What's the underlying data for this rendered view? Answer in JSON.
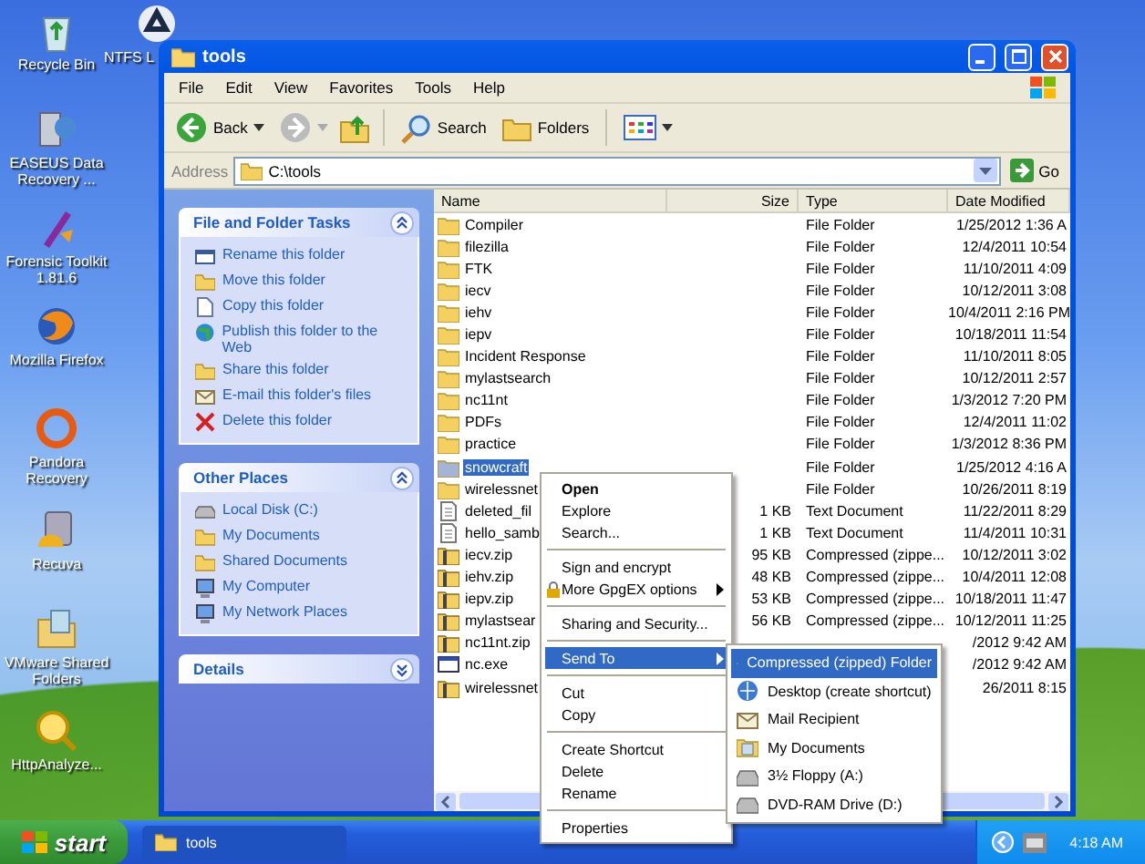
{
  "desktop_icons": [
    {
      "label": "Recycle Bin"
    },
    {
      "label": "NTFS L"
    },
    {
      "label": "EASEUS Data Recovery ..."
    },
    {
      "label": "Forensic Toolkit 1.81.6"
    },
    {
      "label": "Mozilla Firefox"
    },
    {
      "label": "Pandora Recovery"
    },
    {
      "label": "Recuva"
    },
    {
      "label": "VMware Shared Folders"
    },
    {
      "label": "HttpAnalyze..."
    }
  ],
  "window": {
    "title": "tools",
    "menu": [
      "File",
      "Edit",
      "View",
      "Favorites",
      "Tools",
      "Help"
    ],
    "toolbar": {
      "back": "Back",
      "search": "Search",
      "folders": "Folders"
    },
    "address": {
      "label": "Address",
      "value": "C:\\tools",
      "go": "Go"
    }
  },
  "task_panes": [
    {
      "title": "File and Folder Tasks",
      "expanded": true,
      "items": [
        "Rename this folder",
        "Move this folder",
        "Copy this folder",
        "Publish this folder to the Web",
        "Share this folder",
        "E-mail this folder's files",
        "Delete this folder"
      ]
    },
    {
      "title": "Other Places",
      "expanded": true,
      "items": [
        "Local Disk (C:)",
        "My Documents",
        "Shared Documents",
        "My Computer",
        "My Network Places"
      ]
    },
    {
      "title": "Details",
      "expanded": false
    }
  ],
  "file_list": {
    "columns": [
      "Name",
      "Size",
      "Type",
      "Date Modified"
    ],
    "rows": [
      {
        "kind": "folder",
        "name": "Compiler",
        "type": "File Folder",
        "date": "1/25/2012 1:36 A",
        "selected": false
      },
      {
        "kind": "folder",
        "name": "filezilla",
        "type": "File Folder",
        "date": "12/4/2011 10:54",
        "selected": false
      },
      {
        "kind": "folder",
        "name": "FTK",
        "type": "File Folder",
        "date": "11/10/2011 4:09",
        "selected": false
      },
      {
        "kind": "folder",
        "name": "iecv",
        "type": "File Folder",
        "date": "10/12/2011 3:08",
        "selected": false
      },
      {
        "kind": "folder",
        "name": "iehv",
        "type": "File Folder",
        "date": "10/4/2011 2:16 PM",
        "selected": false
      },
      {
        "kind": "folder",
        "name": "iepv",
        "type": "File Folder",
        "date": "10/18/2011 11:54",
        "selected": false
      },
      {
        "kind": "folder",
        "name": "Incident Response",
        "type": "File Folder",
        "date": "11/10/2011 8:05",
        "selected": false
      },
      {
        "kind": "folder",
        "name": "mylastsearch",
        "type": "File Folder",
        "date": "10/12/2011 2:57",
        "selected": false
      },
      {
        "kind": "folder",
        "name": "nc11nt",
        "type": "File Folder",
        "date": "1/3/2012 7:20 PM",
        "selected": false
      },
      {
        "kind": "folder",
        "name": "PDFs",
        "type": "File Folder",
        "date": "12/4/2011 11:02",
        "selected": false
      },
      {
        "kind": "folder",
        "name": "practice",
        "type": "File Folder",
        "date": "1/3/2012 8:36 PM",
        "selected": false
      },
      {
        "kind": "folder",
        "name": "snowcraft",
        "type": "File Folder",
        "date": "1/25/2012 4:16 A",
        "selected": true
      },
      {
        "kind": "folder",
        "name": "wirelessnet",
        "type": "File Folder",
        "date": "10/26/2011 8:19",
        "selected": false
      },
      {
        "kind": "text",
        "name": "deleted_fil",
        "size": "1 KB",
        "type": "Text Document",
        "date": "11/22/2011 8:29",
        "selected": false
      },
      {
        "kind": "text",
        "name": "hello_samb",
        "size": "1 KB",
        "type": "Text Document",
        "date": "11/4/2011 10:31",
        "selected": false
      },
      {
        "kind": "zip",
        "name": "iecv.zip",
        "size": "95 KB",
        "type": "Compressed (zippe...",
        "date": "10/12/2011 3:02",
        "selected": false
      },
      {
        "kind": "zip",
        "name": "iehv.zip",
        "size": "48 KB",
        "type": "Compressed (zippe...",
        "date": "10/4/2011 12:08",
        "selected": false
      },
      {
        "kind": "zip",
        "name": "iepv.zip",
        "size": "53 KB",
        "type": "Compressed (zippe...",
        "date": "10/18/2011 11:47",
        "selected": false
      },
      {
        "kind": "zip",
        "name": "mylastsear",
        "size": "56 KB",
        "type": "Compressed (zippe...",
        "date": "10/12/2011 11:25",
        "selected": false
      },
      {
        "kind": "zip",
        "name": "nc11nt.zip",
        "date": "/2012 9:42 AM",
        "selected": false
      },
      {
        "kind": "exe",
        "name": "nc.exe",
        "date": "/2012 9:42 AM",
        "selected": false
      },
      {
        "kind": "zip",
        "name": "wirelessnet",
        "date": "26/2011 8:15",
        "selected": false
      }
    ]
  },
  "context_menu": {
    "groups": [
      [
        {
          "label": "Open",
          "default": true,
          "submenu": false,
          "selected": false
        },
        {
          "label": "Explore",
          "default": false,
          "submenu": false,
          "selected": false
        },
        {
          "label": "Search...",
          "default": false,
          "submenu": false,
          "selected": false
        }
      ],
      [
        {
          "label": "Sign and encrypt",
          "default": false,
          "submenu": false,
          "selected": false
        },
        {
          "label": "More GpgEX options",
          "default": false,
          "submenu": true,
          "selected": false
        }
      ],
      [
        {
          "label": "Sharing and Security...",
          "default": false,
          "submenu": false,
          "selected": false
        }
      ],
      [
        {
          "label": "Send To",
          "default": false,
          "submenu": true,
          "selected": true
        }
      ],
      [
        {
          "label": "Cut",
          "default": false,
          "submenu": false,
          "selected": false
        },
        {
          "label": "Copy",
          "default": false,
          "submenu": false,
          "selected": false
        }
      ],
      [
        {
          "label": "Create Shortcut",
          "default": false,
          "submenu": false,
          "selected": false
        },
        {
          "label": "Delete",
          "default": false,
          "submenu": false,
          "selected": false
        },
        {
          "label": "Rename",
          "default": false,
          "submenu": false,
          "selected": false
        }
      ],
      [
        {
          "label": "Properties",
          "default": false,
          "submenu": false,
          "selected": false
        }
      ]
    ]
  },
  "send_to_menu": [
    {
      "label": "Compressed (zipped) Folder",
      "selected": true
    },
    {
      "label": "Desktop (create shortcut)",
      "selected": false
    },
    {
      "label": "Mail Recipient",
      "selected": false
    },
    {
      "label": "My Documents",
      "selected": false
    },
    {
      "label": "3½ Floppy (A:)",
      "selected": false
    },
    {
      "label": "DVD-RAM Drive (D:)",
      "selected": false
    }
  ],
  "taskbar": {
    "start": "start",
    "tasks": [
      {
        "label": "tools"
      }
    ],
    "clock": "4:18 AM"
  }
}
